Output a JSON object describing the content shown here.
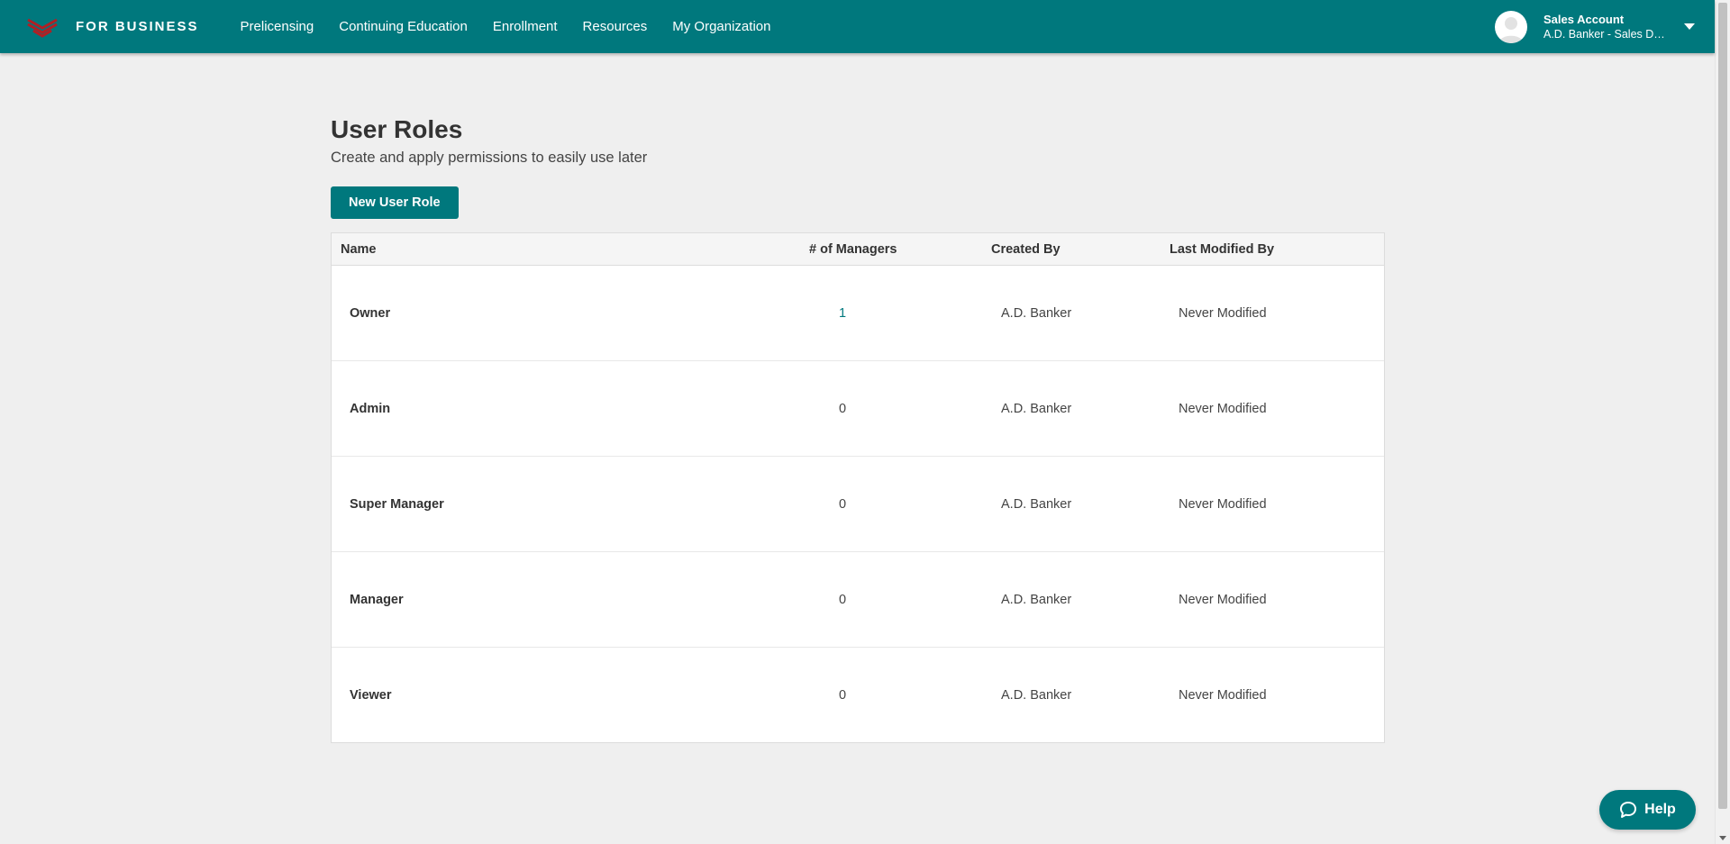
{
  "header": {
    "brand": "FOR BUSINESS",
    "nav": [
      {
        "label": "Prelicensing"
      },
      {
        "label": "Continuing Education"
      },
      {
        "label": "Enrollment"
      },
      {
        "label": "Resources"
      },
      {
        "label": "My Organization"
      }
    ],
    "account": {
      "name": "Sales Account",
      "org": "A.D. Banker - Sales De..."
    }
  },
  "page": {
    "title": "User Roles",
    "subtitle": "Create and apply permissions to easily use later",
    "new_button": "New User Role"
  },
  "table": {
    "columns": {
      "name": "Name",
      "managers": "# of Managers",
      "created_by": "Created By",
      "modified_by": "Last Modified By"
    },
    "rows": [
      {
        "name": "Owner",
        "managers": "1",
        "created_by": "A.D. Banker",
        "modified_by": "Never Modified"
      },
      {
        "name": "Admin",
        "managers": "0",
        "created_by": "A.D. Banker",
        "modified_by": "Never Modified"
      },
      {
        "name": "Super Manager",
        "managers": "0",
        "created_by": "A.D. Banker",
        "modified_by": "Never Modified"
      },
      {
        "name": "Manager",
        "managers": "0",
        "created_by": "A.D. Banker",
        "modified_by": "Never Modified"
      },
      {
        "name": "Viewer",
        "managers": "0",
        "created_by": "A.D. Banker",
        "modified_by": "Never Modified"
      }
    ]
  },
  "help": {
    "label": "Help"
  },
  "icons": {
    "logo": "chevron-stack-logo-icon",
    "avatar": "user-silhouette-icon",
    "account_menu": "caret-down-icon",
    "help": "chat-bubble-icon"
  },
  "colors": {
    "brand_teal": "#00787d",
    "logo_red": "#b11f24",
    "background": "#efefef",
    "header_row": "#f5f5f5"
  }
}
